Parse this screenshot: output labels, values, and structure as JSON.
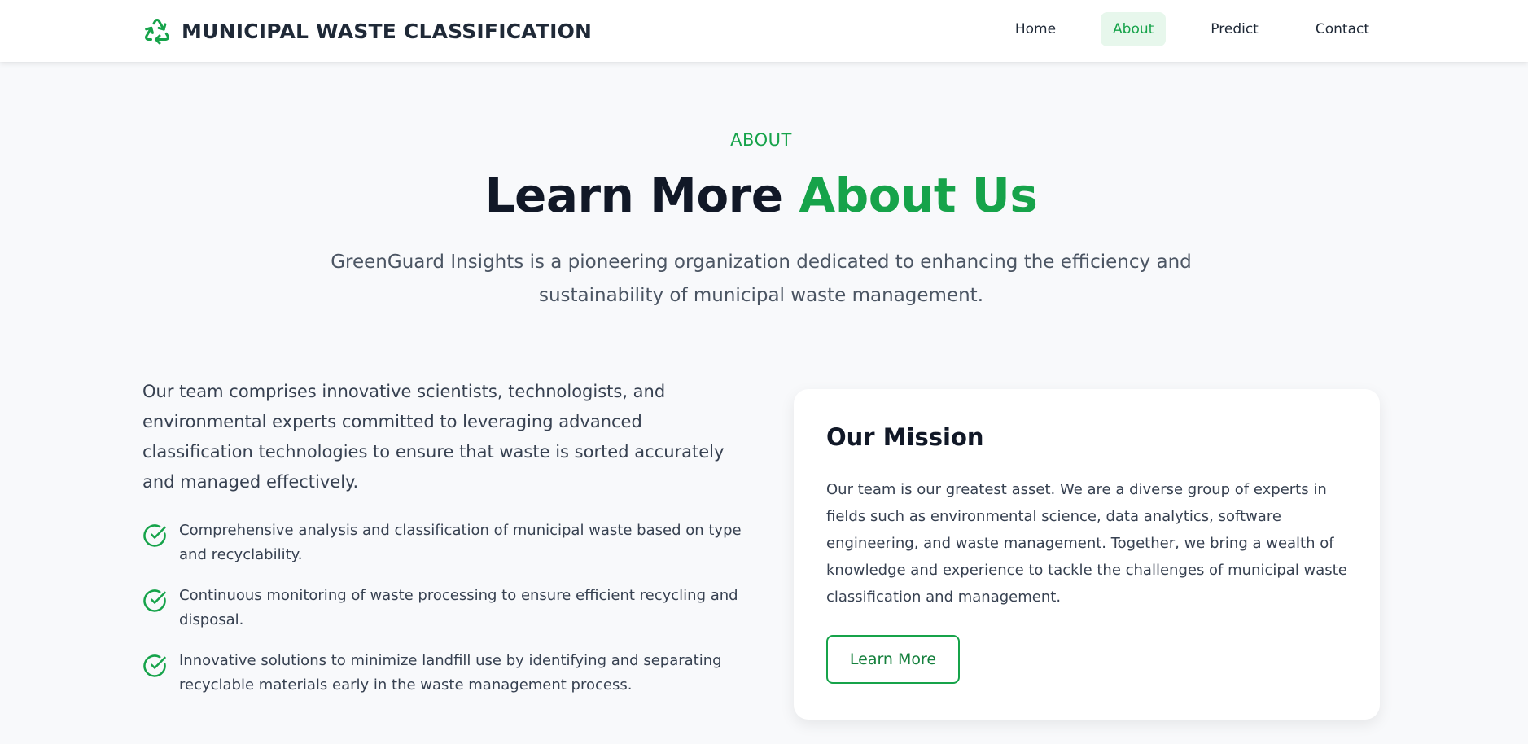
{
  "header": {
    "brand_title": "MUNICIPAL WASTE CLASSIFICATION",
    "logo_icon": "recycle-icon",
    "nav": [
      {
        "label": "Home",
        "active": false
      },
      {
        "label": "About",
        "active": true
      },
      {
        "label": "Predict",
        "active": false
      },
      {
        "label": "Contact",
        "active": false
      }
    ]
  },
  "hero": {
    "eyebrow": "ABOUT",
    "title_main": "Learn More ",
    "title_accent": "About Us",
    "subtitle": "GreenGuard Insights is a pioneering organization dedicated to enhancing the efficiency and sustainability of municipal waste management."
  },
  "about": {
    "intro": "Our team comprises innovative scientists, technologists, and environmental experts committed to leveraging advanced classification technologies to ensure that waste is sorted accurately and managed effectively.",
    "feature_icon": "check-circle-icon",
    "features": [
      "Comprehensive analysis and classification of municipal waste based on type and recyclability.",
      "Continuous monitoring of waste processing to ensure efficient recycling and disposal.",
      "Innovative solutions to minimize landfill use by identifying and separating recyclable materials early in the waste management process."
    ]
  },
  "mission": {
    "title": "Our Mission",
    "body": "Our team is our greatest asset. We are a diverse group of experts in fields such as environmental science, data analytics, software engineering, and waste management. Together, we bring a wealth of knowledge and experience to tackle the challenges of municipal waste classification and management.",
    "button_label": "Learn More"
  },
  "colors": {
    "accent": "#16a34a",
    "heading": "#111827",
    "text": "#374151",
    "background": "#f8f9fb",
    "active_nav_bg": "#e7f7ec"
  }
}
